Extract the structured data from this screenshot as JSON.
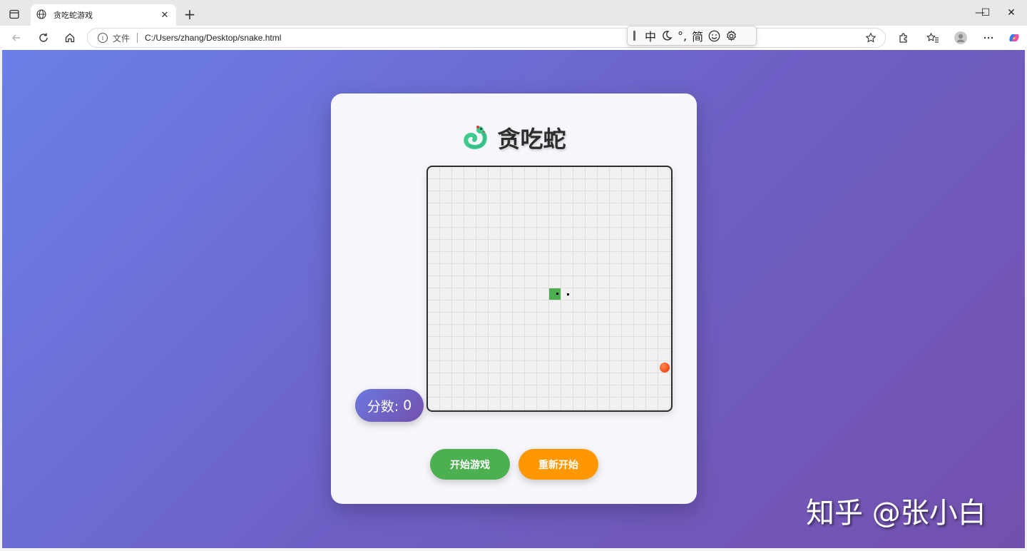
{
  "browser": {
    "tab_title": "贪吃蛇游戏",
    "tab_close": "✕",
    "new_tab": "+",
    "address_scheme": "文件",
    "address_url": "C:/Users/zhang/Desktop/snake.html",
    "info_glyph": "i"
  },
  "ime": {
    "mode": "中",
    "punct": "°,",
    "charset": "简"
  },
  "window_controls": {
    "minimize": "—",
    "maximize": "☐",
    "close": "✕"
  },
  "game": {
    "title": "贪吃蛇",
    "score_label": "分数:",
    "score_value": "0",
    "start_button": "开始游戏",
    "restart_button": "重新开始",
    "colors": {
      "snake": "#4caf50",
      "food": "#f4511e",
      "start": "#4caf50",
      "restart": "#ff9800"
    }
  },
  "watermark": "知乎 @张小白"
}
